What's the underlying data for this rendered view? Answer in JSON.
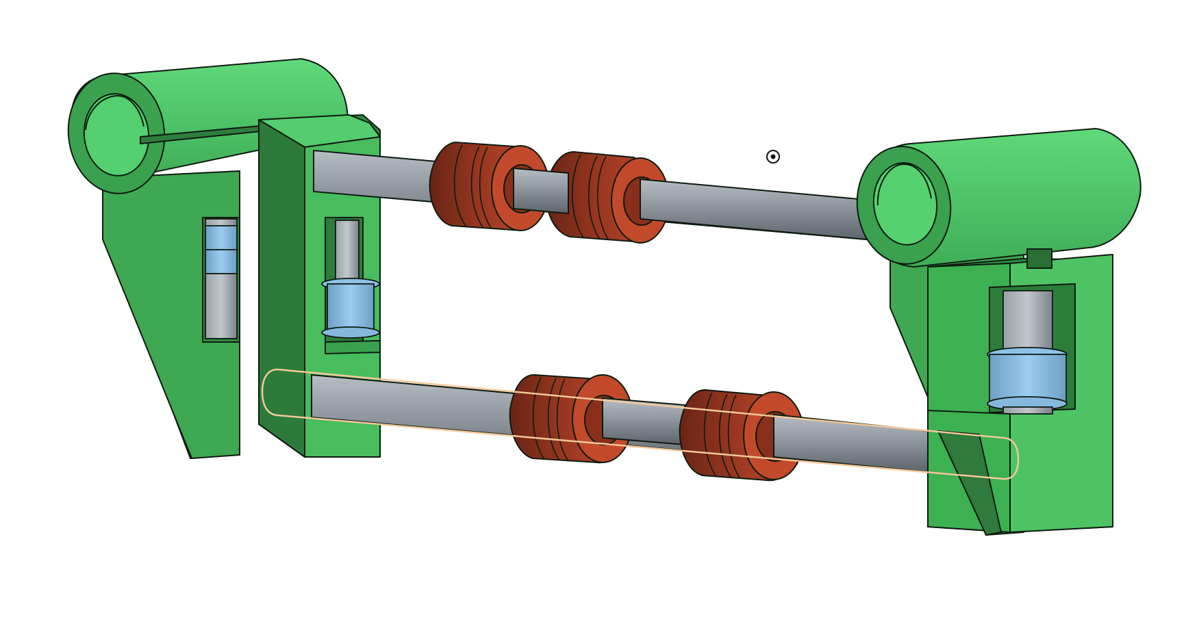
{
  "scene": {
    "description_visible_text": "",
    "cursor_icon": "view-center-target-icon",
    "selection": {
      "state": "hover-highlight",
      "color": "#F5C89A"
    },
    "parts": [
      {
        "name": "left-bracket",
        "color": "#4CC766"
      },
      {
        "name": "right-bracket",
        "color": "#4CC766"
      },
      {
        "name": "top-rod",
        "color": "#9AA0A8"
      },
      {
        "name": "bottom-rod",
        "color": "#9AA0A8"
      },
      {
        "name": "bearing",
        "color": "#C0452A"
      },
      {
        "name": "idler-pulley",
        "color": "#8EC3E6"
      }
    ]
  }
}
